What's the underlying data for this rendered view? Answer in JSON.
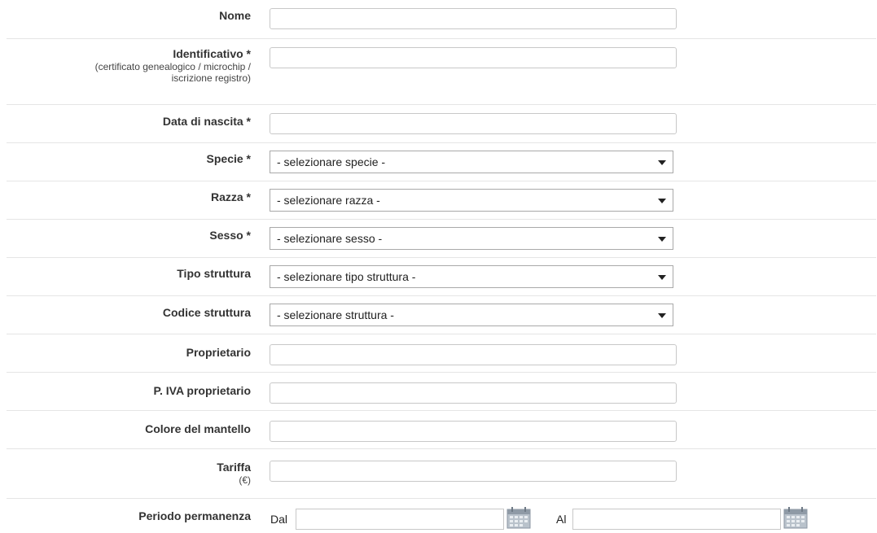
{
  "form": {
    "nome": {
      "label": "Nome",
      "value": ""
    },
    "identificativo": {
      "label": "Identificativo *",
      "sub1": "(certificato genealogico / microchip /",
      "sub2": "iscrizione registro)",
      "value": ""
    },
    "data_nascita": {
      "label": "Data di nascita *",
      "value": ""
    },
    "specie": {
      "label": "Specie *",
      "selected": "- selezionare specie -"
    },
    "razza": {
      "label": "Razza *",
      "selected": "- selezionare razza -"
    },
    "sesso": {
      "label": "Sesso *",
      "selected": "- selezionare sesso -"
    },
    "tipo_struttura": {
      "label": "Tipo struttura",
      "selected": "- selezionare tipo struttura -"
    },
    "codice_struttura": {
      "label": "Codice struttura",
      "selected": "- selezionare struttura -"
    },
    "proprietario": {
      "label": "Proprietario",
      "value": ""
    },
    "piva": {
      "label": "P. IVA proprietario",
      "value": ""
    },
    "colore": {
      "label": "Colore del mantello",
      "value": ""
    },
    "tariffa": {
      "label": "Tariffa",
      "sub": "(€)",
      "value": ""
    },
    "periodo": {
      "label": "Periodo permanenza",
      "dal_label": "Dal",
      "al_label": "Al",
      "dal_value": "",
      "al_value": ""
    }
  },
  "icons": {
    "calendar": "calendar-icon"
  }
}
